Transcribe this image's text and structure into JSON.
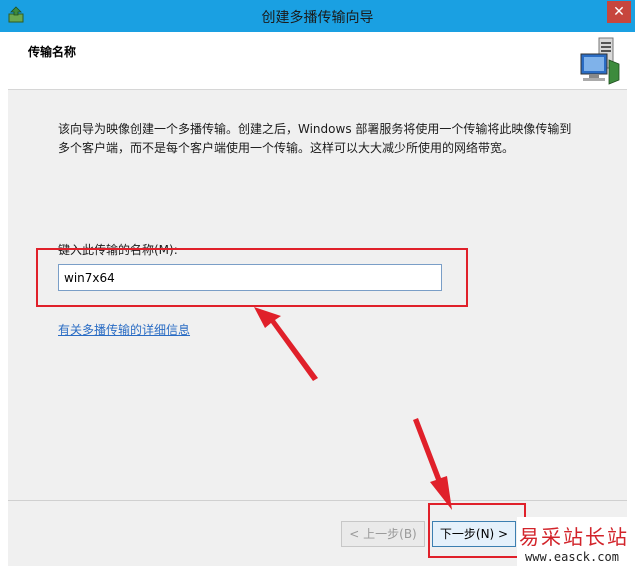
{
  "window": {
    "title": "创建多播传输向导",
    "close_glyph": "✕"
  },
  "header": {
    "title": "传输名称"
  },
  "content": {
    "description": "该向导为映像创建一个多播传输。创建之后，Windows 部署服务将使用一个传输将此映像传输到多个客户端，而不是每个客户端使用一个传输。这样可以大大减少所使用的网络带宽。",
    "field_label": "键入此传输的名称(M):",
    "name_value": "win7x64",
    "details_link": "有关多播传输的详细信息"
  },
  "footer": {
    "back_label": "< 上一步(B)",
    "next_label": "下一步(N) >"
  },
  "watermark": {
    "title": "易采站长站",
    "url": "www.easck.com"
  },
  "colors": {
    "titlebar": "#1aa0e2",
    "close": "#c7463d",
    "highlight": "#e0202a",
    "link": "#2a6cc4"
  },
  "icons": {
    "title_icon": "deployment-icon",
    "header_icon": "server-network-icon"
  }
}
